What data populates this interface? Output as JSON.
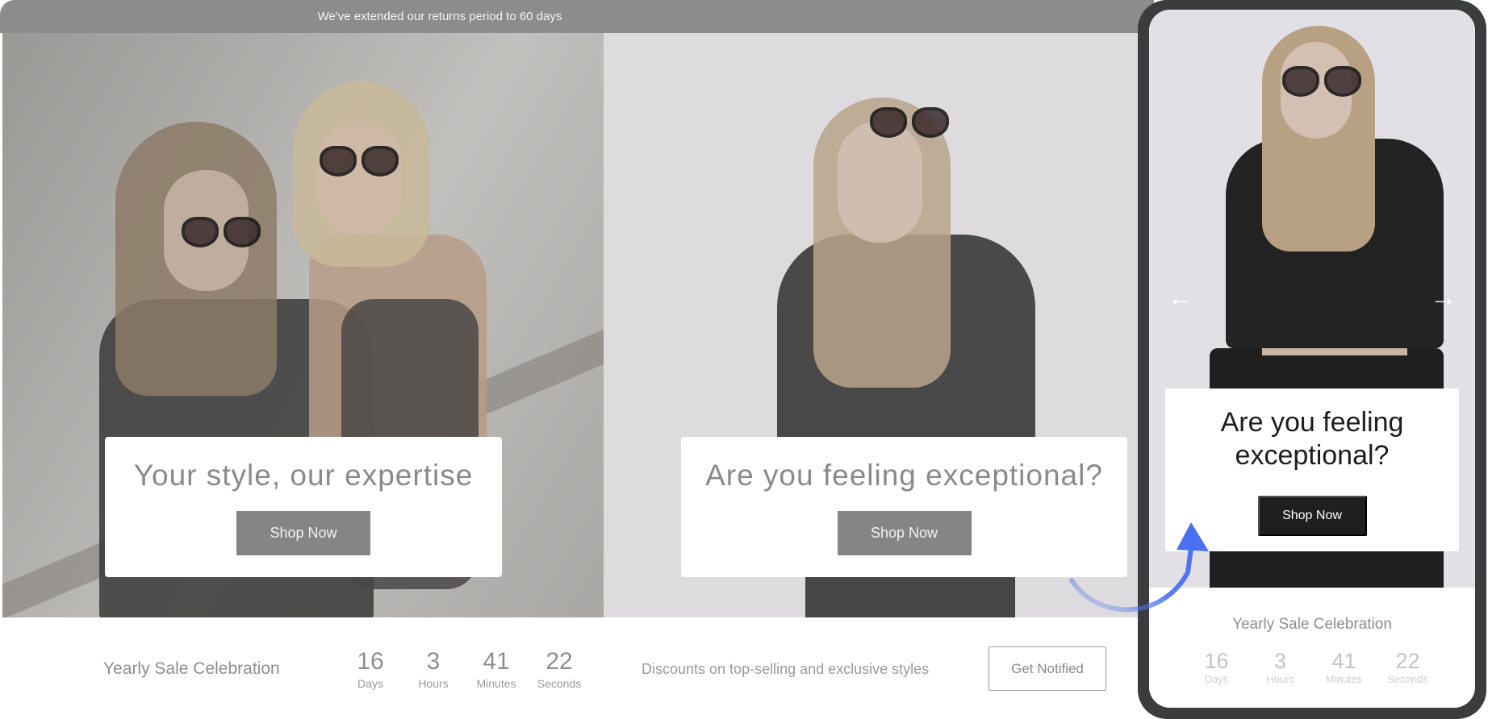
{
  "announcement": "We've extended our returns period to 60 days",
  "desktop": {
    "slides": [
      {
        "title": "Your style, our expertise",
        "button": "Shop Now"
      },
      {
        "title": "Are you feeling exceptional?",
        "button": "Shop Now"
      }
    ],
    "sale": {
      "title": "Yearly Sale Celebration",
      "countdown": [
        {
          "value": "16",
          "label": "Days"
        },
        {
          "value": "3",
          "label": "Hours"
        },
        {
          "value": "41",
          "label": "Minutes"
        },
        {
          "value": "22",
          "label": "Seconds"
        }
      ],
      "description": "Discounts on top-selling and exclusive styles",
      "button": "Get Notified"
    }
  },
  "mobile": {
    "slide": {
      "title": "Are you feeling exceptional?",
      "button": "Shop Now"
    },
    "prev_icon": "←",
    "next_icon": "→",
    "sale": {
      "title": "Yearly Sale Celebration",
      "countdown": [
        {
          "value": "16",
          "label": "Days"
        },
        {
          "value": "3",
          "label": "Hours"
        },
        {
          "value": "41",
          "label": "Minutes"
        },
        {
          "value": "22",
          "label": "Seconds"
        }
      ]
    }
  },
  "colors": {
    "announcement_bg": "#8c8c8c",
    "accent_arrow": "#4a6ff0",
    "phone_frame": "#3b3c3d",
    "mobile_button": "#1f1f1f"
  }
}
